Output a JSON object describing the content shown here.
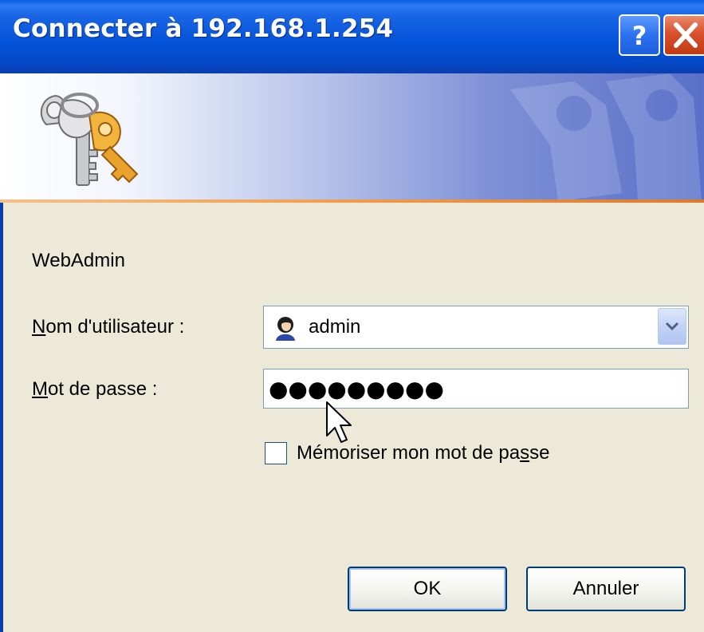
{
  "window": {
    "title": "Connecter à 192.168.1.254"
  },
  "titlebar_buttons": {
    "help_label": "?",
    "close_label": "✕"
  },
  "realm": "WebAdmin",
  "username": {
    "label_mnemonic": "N",
    "label_rest": "om d'utilisateur :",
    "value": "admin"
  },
  "password": {
    "label_mnemonic": "M",
    "label_rest": "ot de passe :",
    "value": "●●●●●●●●●"
  },
  "remember": {
    "label_before": "Mémoriser mon mot de pa",
    "label_mnemonic": "s",
    "label_after": "se",
    "checked": false
  },
  "buttons": {
    "ok": "OK",
    "cancel": "Annuler"
  },
  "colors": {
    "titlebar": "#0553D8",
    "dialog_bg": "#ECE9D8",
    "field_border": "#7F9DB9",
    "accent_line": "#F29B4A"
  }
}
